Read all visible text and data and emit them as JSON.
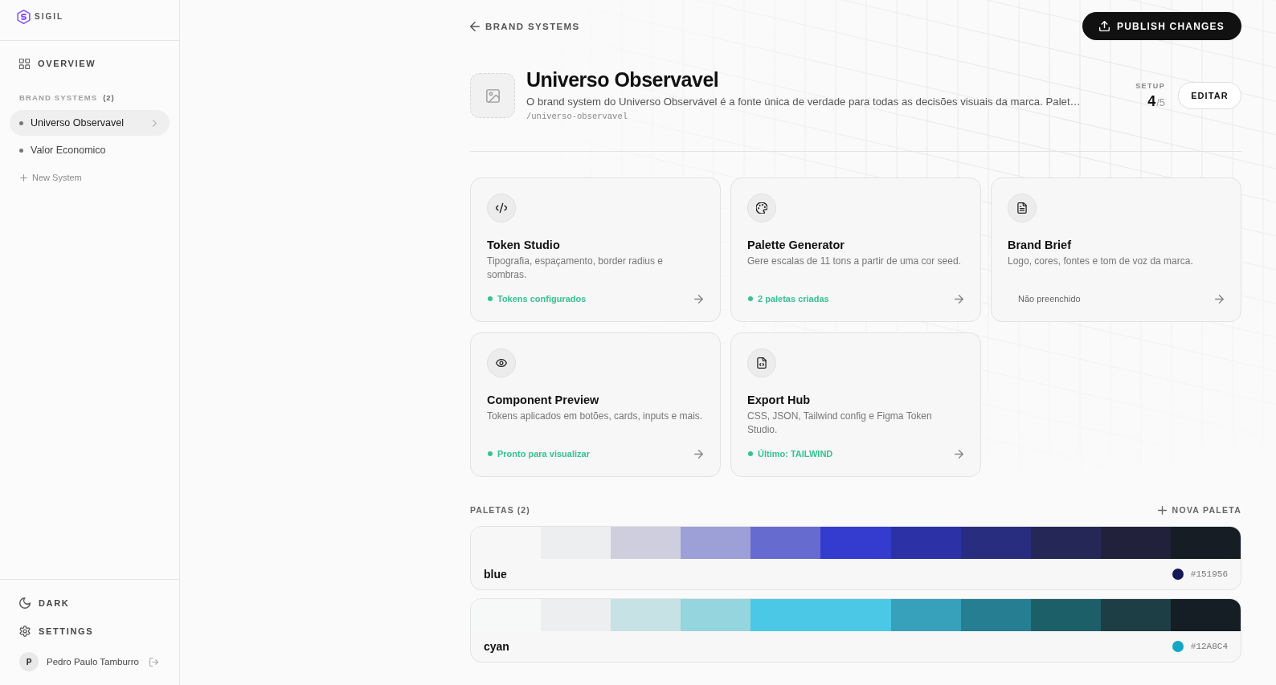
{
  "sidebar": {
    "logo_text": "SIGIL",
    "overview": "OVERVIEW",
    "section_label": "BRAND SYSTEMS",
    "section_count": "(2)",
    "systems": [
      {
        "name": "Universo Observavel",
        "selected": true
      },
      {
        "name": "Valor Economico",
        "selected": false
      }
    ],
    "new_system": "New System",
    "footer_items": [
      {
        "label": "DARK"
      },
      {
        "label": "SETTINGS"
      }
    ],
    "user": {
      "initial": "P",
      "name": "Pedro Paulo Tamburro"
    }
  },
  "top_bar": {
    "back_link": "BRAND SYSTEMS",
    "publish_button": "PUBLISH CHANGES"
  },
  "system": {
    "title": "Universo Observavel",
    "description": "O brand system do Universo Observável é a fonte única de verdade para todas as decisões visuais da marca. Palet…",
    "slug": "/universo-observavel",
    "setup": {
      "label": "SETUP",
      "count": "4",
      "total": "/5"
    },
    "edit_button": "EDITAR"
  },
  "tools": [
    {
      "title": "Token Studio",
      "description": "Tipografia, espaçamento, border radius e sombras.",
      "status": "Tokens configurados",
      "complete": true
    },
    {
      "title": "Palette Generator",
      "description": "Gere escalas de 11 tons a partir de uma cor seed.",
      "status": "2 paletas criadas",
      "complete": true
    },
    {
      "title": "Brand Brief",
      "description": "Logo, cores, fontes e tom de voz da marca.",
      "status": "Não preenchido",
      "complete": false
    },
    {
      "title": "Component Preview",
      "description": "Tokens aplicados em botões, cards, inputs e mais.",
      "status": "Pronto para visualizar",
      "complete": true
    },
    {
      "title": "Export Hub",
      "description": "CSS, JSON, Tailwind config e Figma Token Studio.",
      "status": "Último: TAILWIND",
      "complete": true
    }
  ],
  "palettes": {
    "label": "PALETAS (2)",
    "add_button": "NOVA PALETA",
    "items": [
      {
        "name": "blue",
        "hex": "#151956",
        "color": "#151956",
        "swatches": [
          {
            "color": "#f7f7f8"
          },
          {
            "color": "#edeef0"
          },
          {
            "color": "#cfcedf"
          },
          {
            "color": "#9da0d6"
          },
          {
            "color": "#666bcf"
          },
          {
            "color": "#333ccf"
          },
          {
            "color": "#2c32a5"
          },
          {
            "color": "#292d80"
          },
          {
            "color": "#252857"
          },
          {
            "color": "#21213c"
          },
          {
            "color": "#171d25"
          }
        ]
      },
      {
        "name": "cyan",
        "hex": "#12A8C4",
        "color": "#12a8c4",
        "swatches": [
          {
            "color": "#f7f8f8"
          },
          {
            "color": "#eceef0"
          },
          {
            "color": "#c6e2e5"
          },
          {
            "color": "#94d5de"
          },
          {
            "color": "#4bc8e6"
          },
          {
            "color": "#4bc8e6"
          },
          {
            "color": "#37a0bb"
          },
          {
            "color": "#267e92"
          },
          {
            "color": "#1d5f69"
          },
          {
            "color": "#1d3e45"
          },
          {
            "color": "#161e25"
          }
        ]
      }
    ]
  }
}
